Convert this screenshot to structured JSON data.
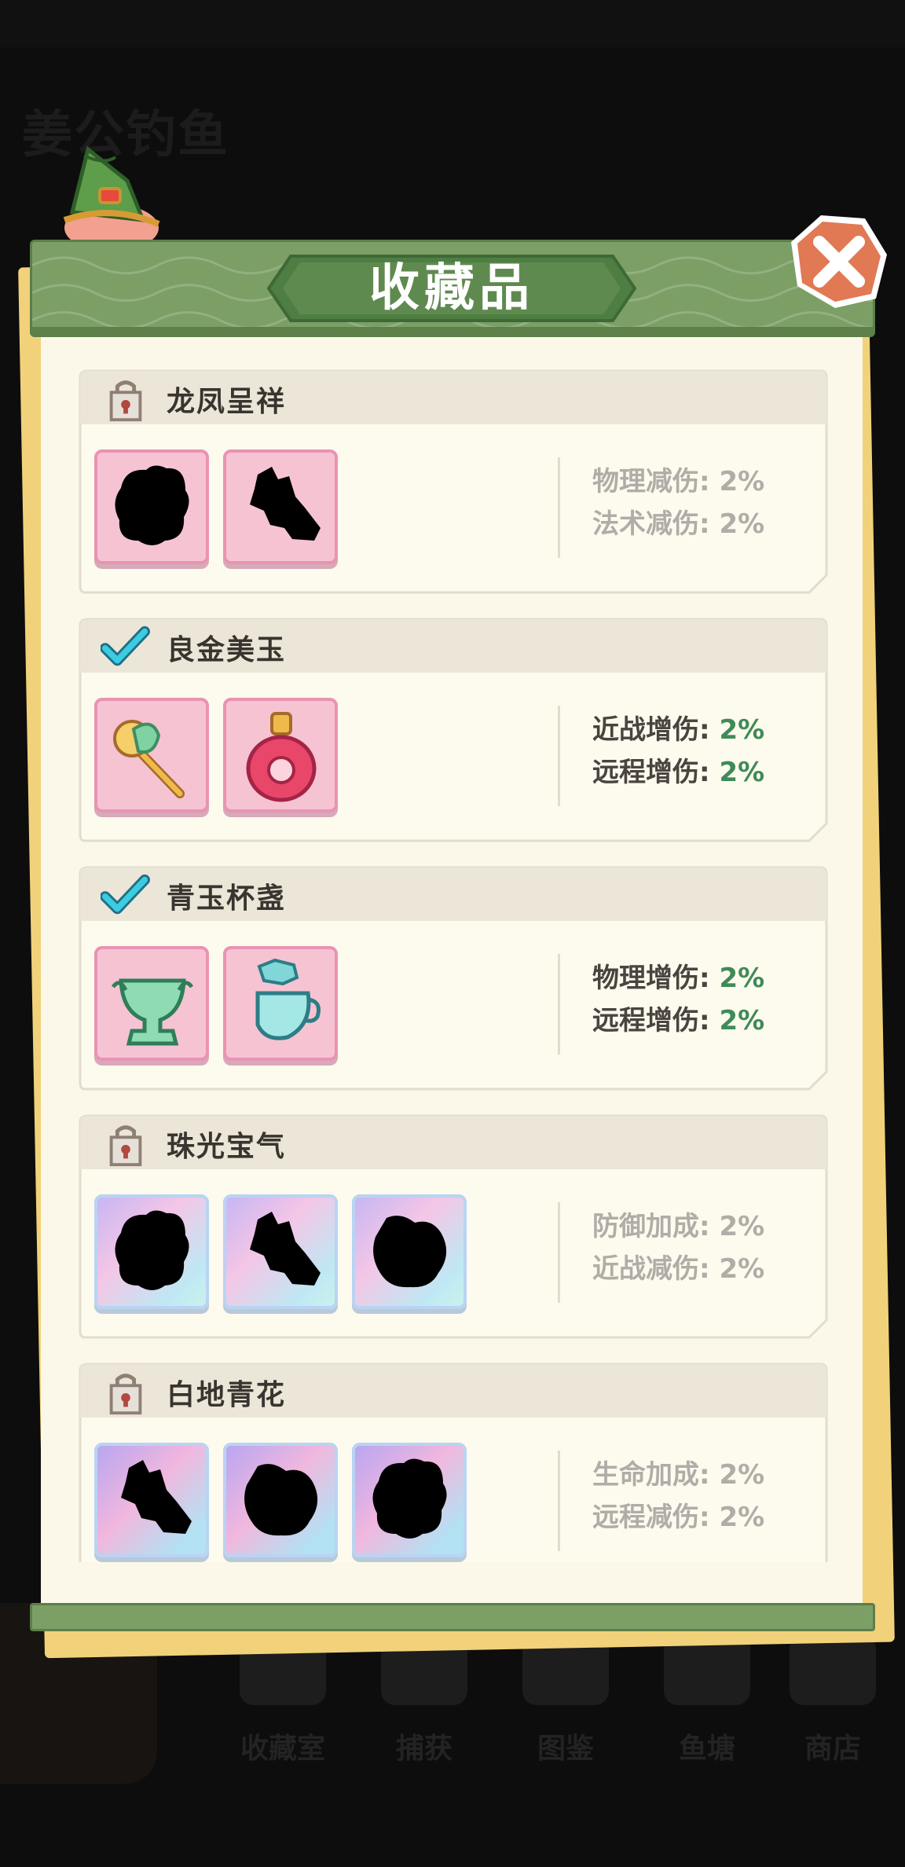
{
  "background": {
    "title": "姜公钓鱼",
    "nav_labels": [
      "收藏室",
      "捕获",
      "图鉴",
      "鱼塘",
      "商店"
    ]
  },
  "panel": {
    "title": "收藏品",
    "close_icon": "close-x-icon"
  },
  "collections": [
    {
      "name": "龙凤呈祥",
      "status": "locked",
      "status_icon": "lock-icon",
      "slot_style": "pink",
      "items": [
        "silhouette-locked",
        "silhouette-locked"
      ],
      "stats": [
        {
          "label": "物理减伤: ",
          "value": "2%"
        },
        {
          "label": "法术减伤: ",
          "value": "2%"
        }
      ]
    },
    {
      "name": "良金美玉",
      "status": "completed",
      "status_icon": "checkmark-icon",
      "slot_style": "pink",
      "items": [
        "jade-scepter-icon",
        "ruby-pendant-icon"
      ],
      "stats": [
        {
          "label": "近战增伤: ",
          "value": "2%"
        },
        {
          "label": "远程增伤: ",
          "value": "2%"
        }
      ]
    },
    {
      "name": "青玉杯盏",
      "status": "completed",
      "status_icon": "checkmark-icon",
      "slot_style": "pink",
      "items": [
        "jade-goblet-icon",
        "jade-teapot-icon"
      ],
      "stats": [
        {
          "label": "物理增伤: ",
          "value": "2%"
        },
        {
          "label": "远程增伤: ",
          "value": "2%"
        }
      ]
    },
    {
      "name": "珠光宝气",
      "status": "locked",
      "status_icon": "lock-icon",
      "slot_style": "holo",
      "items": [
        "silhouette-locked",
        "silhouette-locked",
        "silhouette-locked"
      ],
      "stats": [
        {
          "label": "防御加成: ",
          "value": "2%"
        },
        {
          "label": "近战减伤: ",
          "value": "2%"
        }
      ]
    },
    {
      "name": "白地青花",
      "status": "locked",
      "status_icon": "lock-icon",
      "slot_style": "holo2",
      "items": [
        "silhouette-locked",
        "silhouette-locked",
        "silhouette-locked"
      ],
      "stats": [
        {
          "label": "生命加成: ",
          "value": "2%"
        },
        {
          "label": "远程减伤: ",
          "value": "2%"
        }
      ]
    }
  ],
  "colors": {
    "header_green": "#7b9f65",
    "title_plate_green": "#5f8a4f",
    "close_orange": "#e07954",
    "active_value_green": "#3f8b58",
    "check_cyan": "#36c6d9",
    "paper": "#fcf8e9"
  }
}
